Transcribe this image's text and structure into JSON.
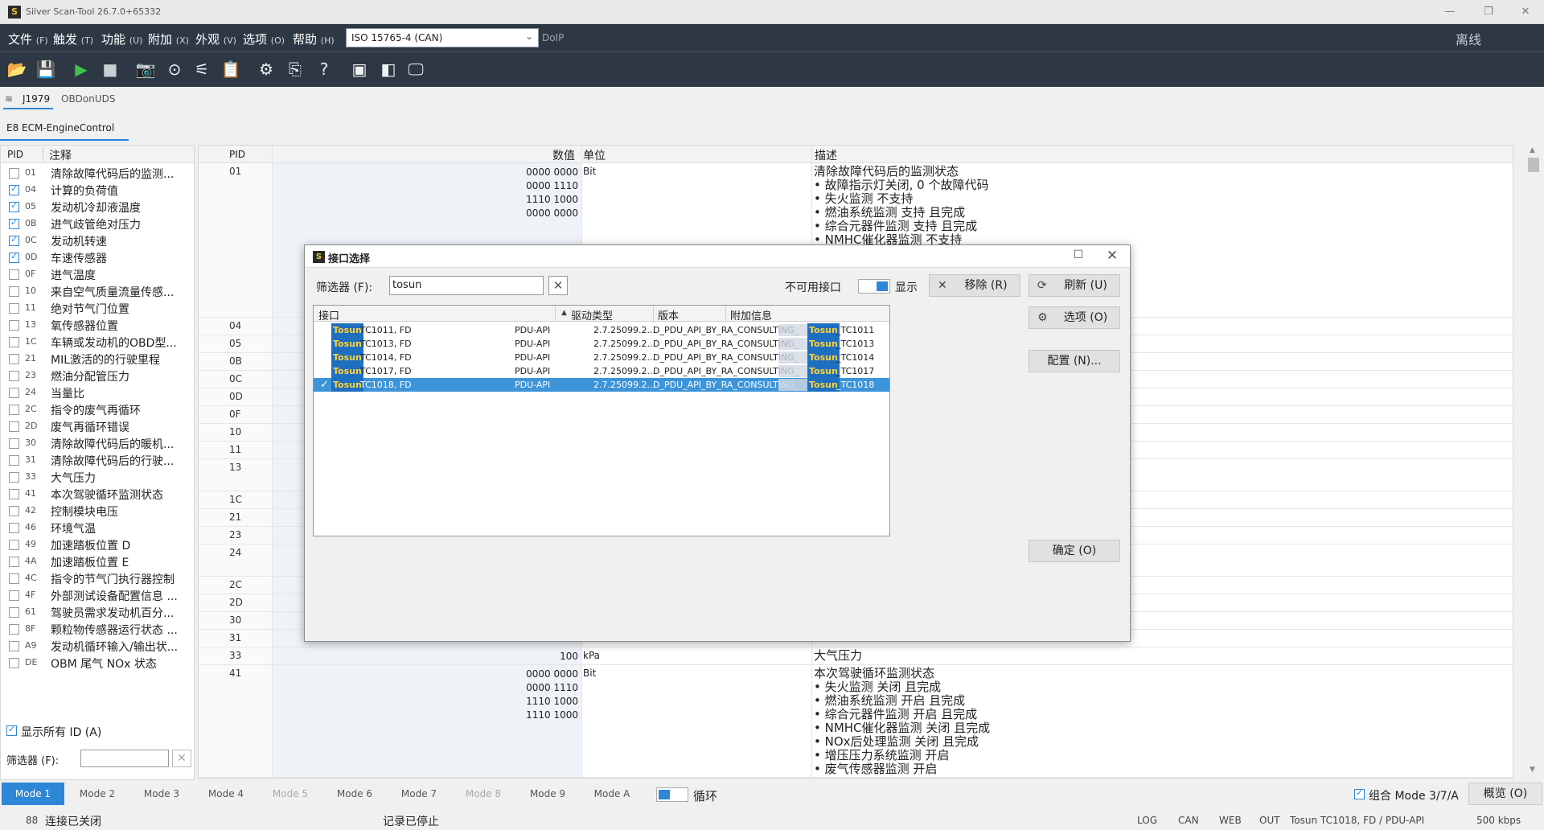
{
  "window": {
    "title": "Silver Scan-Tool 26.7.0+65332",
    "minimize": "—",
    "restore": "❐",
    "close": "✕"
  },
  "menu": [
    {
      "label": "文件",
      "key": "(F)"
    },
    {
      "label": "触发",
      "key": "(T)"
    },
    {
      "label": "功能",
      "key": "(U)"
    },
    {
      "label": "附加",
      "key": "(X)"
    },
    {
      "label": "外观",
      "key": "(V)"
    },
    {
      "label": "选项",
      "key": "(O)"
    },
    {
      "label": "帮助",
      "key": "(H)"
    }
  ],
  "protocol": "ISO 15765-4 (CAN)",
  "doip": "DoIP",
  "offline": "离线",
  "bus_tabs": [
    "J1979",
    "OBDonUDS"
  ],
  "ecu_tab": "E8   ECM-EngineControl",
  "left": {
    "header_pid": "PID",
    "header_note": "注释",
    "rows": [
      {
        "pid": "01",
        "note": "清除故障代码后的监测...",
        "checked": false
      },
      {
        "pid": "04",
        "note": "计算的负荷值",
        "checked": true
      },
      {
        "pid": "05",
        "note": "发动机冷却液温度",
        "checked": true
      },
      {
        "pid": "0B",
        "note": "进气歧管绝对压力",
        "checked": true
      },
      {
        "pid": "0C",
        "note": "发动机转速",
        "checked": true
      },
      {
        "pid": "0D",
        "note": "车速传感器",
        "checked": true
      },
      {
        "pid": "0F",
        "note": "进气温度",
        "checked": false
      },
      {
        "pid": "10",
        "note": "来自空气质量流量传感...",
        "checked": false
      },
      {
        "pid": "11",
        "note": "绝对节气门位置",
        "checked": false
      },
      {
        "pid": "13",
        "note": "氧传感器位置",
        "checked": false
      },
      {
        "pid": "1C",
        "note": "车辆或发动机的OBD型...",
        "checked": false
      },
      {
        "pid": "21",
        "note": "MIL激活的的行驶里程",
        "checked": false
      },
      {
        "pid": "23",
        "note": "燃油分配管压力",
        "checked": false
      },
      {
        "pid": "24",
        "note": "当量比",
        "checked": false
      },
      {
        "pid": "2C",
        "note": "指令的废气再循环",
        "checked": false
      },
      {
        "pid": "2D",
        "note": "废气再循环错误",
        "checked": false
      },
      {
        "pid": "30",
        "note": "清除故障代码后的暖机...",
        "checked": false
      },
      {
        "pid": "31",
        "note": "清除故障代码后的行驶...",
        "checked": false
      },
      {
        "pid": "33",
        "note": "大气压力",
        "checked": false
      },
      {
        "pid": "41",
        "note": "本次驾驶循环监测状态",
        "checked": false
      },
      {
        "pid": "42",
        "note": "控制模块电压",
        "checked": false
      },
      {
        "pid": "46",
        "note": "环境气温",
        "checked": false
      },
      {
        "pid": "49",
        "note": "加速踏板位置 D",
        "checked": false
      },
      {
        "pid": "4A",
        "note": "加速踏板位置 E",
        "checked": false
      },
      {
        "pid": "4C",
        "note": "指令的节气门执行器控制",
        "checked": false
      },
      {
        "pid": "4F",
        "note": "外部测试设备配置信息 ...",
        "checked": false
      },
      {
        "pid": "61",
        "note": "驾驶员需求发动机百分...",
        "checked": false
      },
      {
        "pid": "8F",
        "note": "颗粒物传感器运行状态 ...",
        "checked": false
      },
      {
        "pid": "A9",
        "note": "发动机循环输入/输出状...",
        "checked": false
      },
      {
        "pid": "DE",
        "note": "OBM 尾气 NOx 状态",
        "checked": false
      }
    ],
    "show_all": "显示所有 ID (A)",
    "filter_label": "筛选器 (F):",
    "filter_value": ""
  },
  "grid": {
    "headers": {
      "pid": "PID",
      "value": "数值",
      "unit": "单位",
      "desc": "描述"
    },
    "rows": [
      {
        "pid": "01",
        "value": "0000 0000\n0000 1110\n1110 1000\n0000 0000",
        "unit": "Bit",
        "desc": "清除故障代码后的监测状态\n• 故障指示灯关闭, 0 个故障代码\n• 失火监测 不支持\n• 燃油系统监测 支持 且完成\n• 综合元器件监测 支持 且完成\n• NMHC催化器监测 不支持"
      },
      {
        "pid": "04",
        "value": "",
        "unit": "",
        "desc": ""
      },
      {
        "pid": "05",
        "value": "",
        "unit": "",
        "desc": ""
      },
      {
        "pid": "0B",
        "value": "",
        "unit": "",
        "desc": ""
      },
      {
        "pid": "0C",
        "value": "",
        "unit": "",
        "desc": ""
      },
      {
        "pid": "0D",
        "value": "",
        "unit": "",
        "desc": ""
      },
      {
        "pid": "0F",
        "value": "",
        "unit": "",
        "desc": ""
      },
      {
        "pid": "10",
        "value": "",
        "unit": "",
        "desc": ""
      },
      {
        "pid": "11",
        "value": "",
        "unit": "",
        "desc": ""
      },
      {
        "pid": "13",
        "value": "",
        "unit": "",
        "desc": ""
      },
      {
        "pid": "1C",
        "value": "",
        "unit": "",
        "desc": ""
      },
      {
        "pid": "21",
        "value": "",
        "unit": "",
        "desc": ""
      },
      {
        "pid": "23",
        "value": "",
        "unit": "",
        "desc": ""
      },
      {
        "pid": "24",
        "value": "",
        "unit": "",
        "desc": ""
      },
      {
        "pid": "2C",
        "value": "",
        "unit": "",
        "desc": ""
      },
      {
        "pid": "2D",
        "value": "",
        "unit": "",
        "desc": ""
      },
      {
        "pid": "30",
        "value": "",
        "unit": "",
        "desc": ""
      },
      {
        "pid": "31",
        "value": "",
        "unit": "",
        "desc": ""
      },
      {
        "pid": "33",
        "value": "100",
        "unit": "kPa",
        "desc": "大气压力"
      },
      {
        "pid": "41",
        "value": "0000 0000\n0000 1110\n1110 1000\n1110 1000",
        "unit": "Bit",
        "desc": "本次驾驶循环监测状态\n• 失火监测 关闭 且完成\n• 燃油系统监测 开启 且完成\n• 综合元器件监测 开启 且完成\n• NMHC催化器监测 关闭 且完成\n• NOx后处理监测 关闭 且完成\n• 增压压力系统监测 开启\n• 废气传感器监测 开启"
      }
    ]
  },
  "modes": [
    {
      "label": "Mode 1",
      "active": true,
      "dim": false
    },
    {
      "label": "Mode 2",
      "active": false,
      "dim": false
    },
    {
      "label": "Mode 3",
      "active": false,
      "dim": false
    },
    {
      "label": "Mode 4",
      "active": false,
      "dim": false
    },
    {
      "label": "Mode 5",
      "active": false,
      "dim": true
    },
    {
      "label": "Mode 6",
      "active": false,
      "dim": false
    },
    {
      "label": "Mode 7",
      "active": false,
      "dim": false
    },
    {
      "label": "Mode 8",
      "active": false,
      "dim": true
    },
    {
      "label": "Mode 9",
      "active": false,
      "dim": false
    },
    {
      "label": "Mode A",
      "active": false,
      "dim": false
    }
  ],
  "loop_label": "循环",
  "combo_label": "组合 Mode 3/7/A",
  "overview_label": "概览 (O)",
  "status": {
    "count": "88",
    "connection": "连接已关闭",
    "recording": "记录已停止",
    "log": "LOG",
    "can": "CAN",
    "web": "WEB",
    "out": "OUT",
    "interface": "Tosun TC1018, FD / PDU-API",
    "baud": "500 kbps"
  },
  "dialog": {
    "title": "接口选择",
    "filter_label": "筛选器 (F):",
    "filter_value": "tosun",
    "unavailable_label": "不可用接口",
    "show_label": "显示",
    "remove": "移除 (R)",
    "refresh": "刷新 (U)",
    "options": "选项 (O)",
    "config": "配置 (N)...",
    "ok": "确定 (O)",
    "columns": {
      "iface": "接口",
      "driver": "驱动类型",
      "version": "版本",
      "extra": "附加信息"
    },
    "rows": [
      {
        "brand": "Tosun",
        "model": "TC1011, FD",
        "driver": "PDU-API",
        "version": "2.7.25099.2...",
        "extra_prefix": "D_PDU_API_BY_RA_CONSULTING_",
        "extra_brand": "Tosun",
        "extra_suffix": "_TC1011",
        "selected": false
      },
      {
        "brand": "Tosun",
        "model": "TC1013, FD",
        "driver": "PDU-API",
        "version": "2.7.25099.2...",
        "extra_prefix": "D_PDU_API_BY_RA_CONSULTING_",
        "extra_brand": "Tosun",
        "extra_suffix": "_TC1013",
        "selected": false
      },
      {
        "brand": "Tosun",
        "model": "TC1014, FD",
        "driver": "PDU-API",
        "version": "2.7.25099.2...",
        "extra_prefix": "D_PDU_API_BY_RA_CONSULTING_",
        "extra_brand": "Tosun",
        "extra_suffix": "_TC1014",
        "selected": false
      },
      {
        "brand": "Tosun",
        "model": "TC1017, FD",
        "driver": "PDU-API",
        "version": "2.7.25099.2...",
        "extra_prefix": "D_PDU_API_BY_RA_CONSULTING_",
        "extra_brand": "Tosun",
        "extra_suffix": "_TC1017",
        "selected": false
      },
      {
        "brand": "Tosun",
        "model": "TC1018, FD",
        "driver": "PDU-API",
        "version": "2.7.25099.2...",
        "extra_prefix": "D_PDU_API_BY_RA_CONSULTING_",
        "extra_brand": "Tosun",
        "extra_suffix": "_TC1018",
        "selected": true
      }
    ]
  },
  "colors": {
    "accent": "#2e86d6",
    "menubar": "#2e3844",
    "tag_bg": "#1f6fc0",
    "tag_fg": "#ffd23c"
  }
}
